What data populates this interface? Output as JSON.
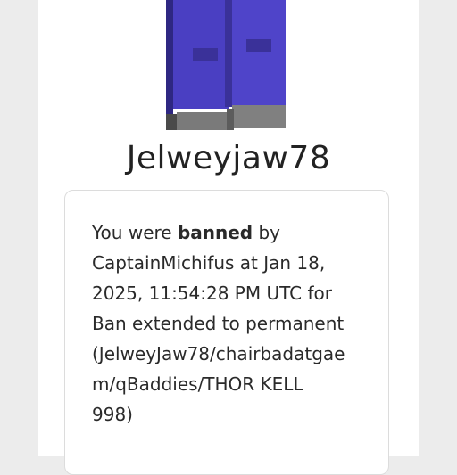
{
  "profile": {
    "username": "Jelweyjaw78",
    "avatar_icon": "avatar-legs-icon"
  },
  "ban_notice": {
    "prefix": "You were ",
    "status_word": "banned",
    "by_word": " by",
    "lines": [
      "CaptainMichifus at Jan 18,",
      "2025, 11:54:28 PM UTC for",
      "Ban extended to permanent",
      "(JelweyJaw78/chairbadatgae",
      "m/qBaddies/THOR KELL",
      "998)"
    ]
  },
  "colors": {
    "pants": "#4a3fc2",
    "pants_shadow": "#3a3199",
    "shoes": "#7a7a7a",
    "shoes_shadow": "#5c5c5c"
  }
}
